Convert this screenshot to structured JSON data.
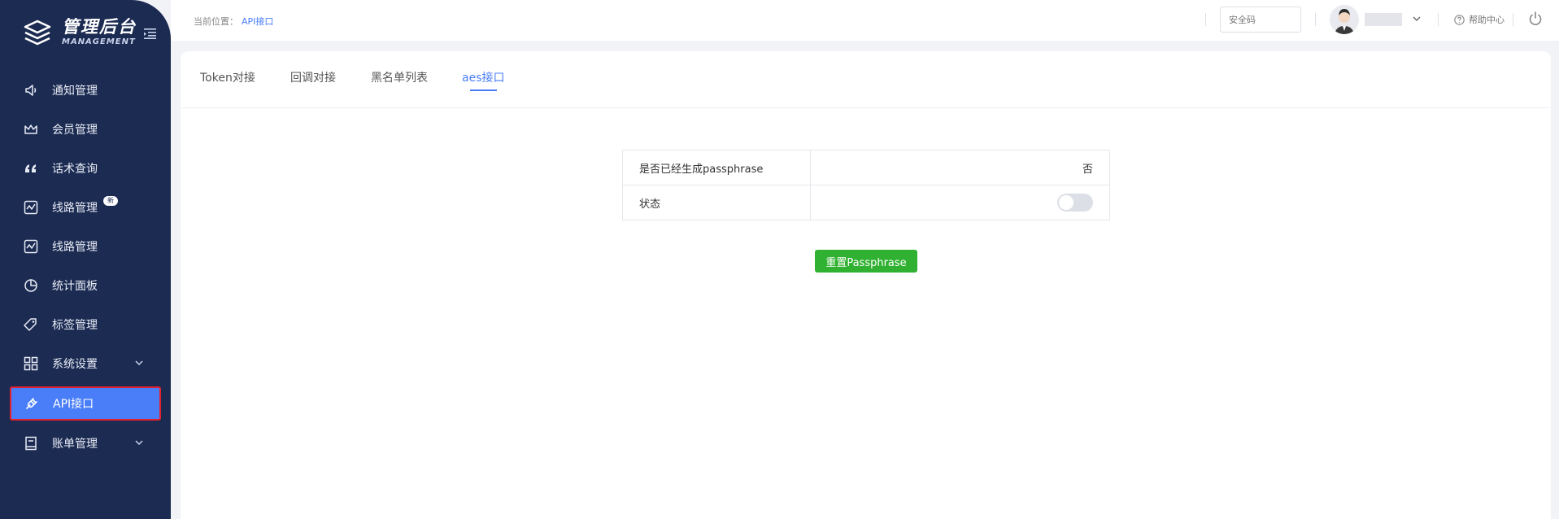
{
  "sidebar": {
    "logo_title": "管理后台",
    "logo_sub": "MANAGEMENT",
    "items": [
      {
        "label": "通知管理",
        "icon": "speaker-icon"
      },
      {
        "label": "会员管理",
        "icon": "crown-icon"
      },
      {
        "label": "话术查询",
        "icon": "quote-icon"
      },
      {
        "label": "线路管理",
        "icon": "route-icon",
        "badge": "新"
      },
      {
        "label": "线路管理",
        "icon": "route-icon"
      },
      {
        "label": "统计面板",
        "icon": "pie-chart-icon"
      },
      {
        "label": "标签管理",
        "icon": "tag-icon"
      },
      {
        "label": "系统设置",
        "icon": "grid-icon",
        "has_children": true
      },
      {
        "label": "API接口",
        "icon": "plug-icon",
        "active": true
      },
      {
        "label": "账单管理",
        "icon": "book-icon",
        "has_children": true
      }
    ]
  },
  "topbar": {
    "breadcrumb_prefix": "当前位置：",
    "breadcrumb_current": "API接口",
    "security_placeholder": "安全码",
    "help_label": "帮助中心"
  },
  "tabs": [
    {
      "label": "Token对接"
    },
    {
      "label": "回调对接"
    },
    {
      "label": "黑名单列表"
    },
    {
      "label": "aes接口",
      "active": true
    }
  ],
  "table": {
    "row1_label": "是否已经生成passphrase",
    "row1_value": "否",
    "row2_label": "状态",
    "row2_switch_on": false
  },
  "reset_button": "重置Passphrase",
  "colors": {
    "sidebar_bg": "#1c2b52",
    "accent": "#4a7ef9",
    "button_green": "#31b131",
    "highlight_border": "#e5202c"
  }
}
